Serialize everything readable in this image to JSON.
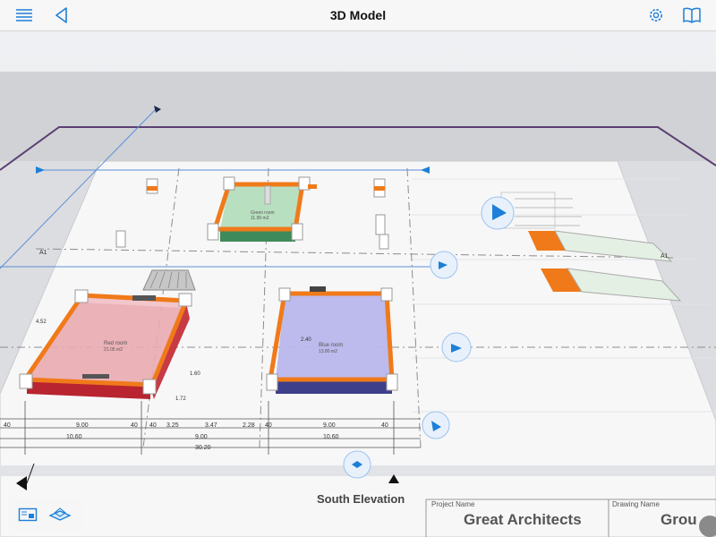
{
  "navbar": {
    "title": "3D Model",
    "menu_icon": "list-menu-icon",
    "back_icon": "back-chevron-icon",
    "settings_icon": "gear-icon",
    "book_icon": "open-book-icon"
  },
  "model": {
    "rooms": [
      {
        "name": "Red room",
        "area": "21.05 m2",
        "color": "#e88a92"
      },
      {
        "name": "Blue room",
        "area": "13.80 m2",
        "color": "#9a9ae0"
      },
      {
        "name": "Green room",
        "area": "11.95 m2",
        "color": "#8fc79a"
      }
    ],
    "small_labels": {
      "left_4_52": "4.52",
      "mid_2_40": "2.40",
      "vertical_1_72": "1.72",
      "vertical_1_60": "1.60"
    },
    "dimension_row_1": [
      "40",
      "9.00",
      "40",
      "40",
      "3.25",
      "3.47",
      "2.28",
      "40",
      "9.00",
      "40"
    ],
    "dimension_row_2": [
      "10.60",
      "9.00",
      "10.60"
    ],
    "dimension_row_3": [
      "30.20"
    ],
    "grid_labels": {
      "left": "A1",
      "right": "A1"
    },
    "elevation_label": "South Elevation",
    "title_block": {
      "project_label": "Project Name",
      "project_value": "Great Architects",
      "drawing_label": "Drawing Name",
      "drawing_value": "Grou"
    }
  },
  "toolbar": {
    "view_2d_icon": "2d-sheet-view-icon",
    "view_3d_icon": "3d-model-view-icon"
  },
  "colors": {
    "accent": "#1e7fd8",
    "wall_orange": "#f07a1a",
    "boundary_purple": "#5b3f73"
  }
}
